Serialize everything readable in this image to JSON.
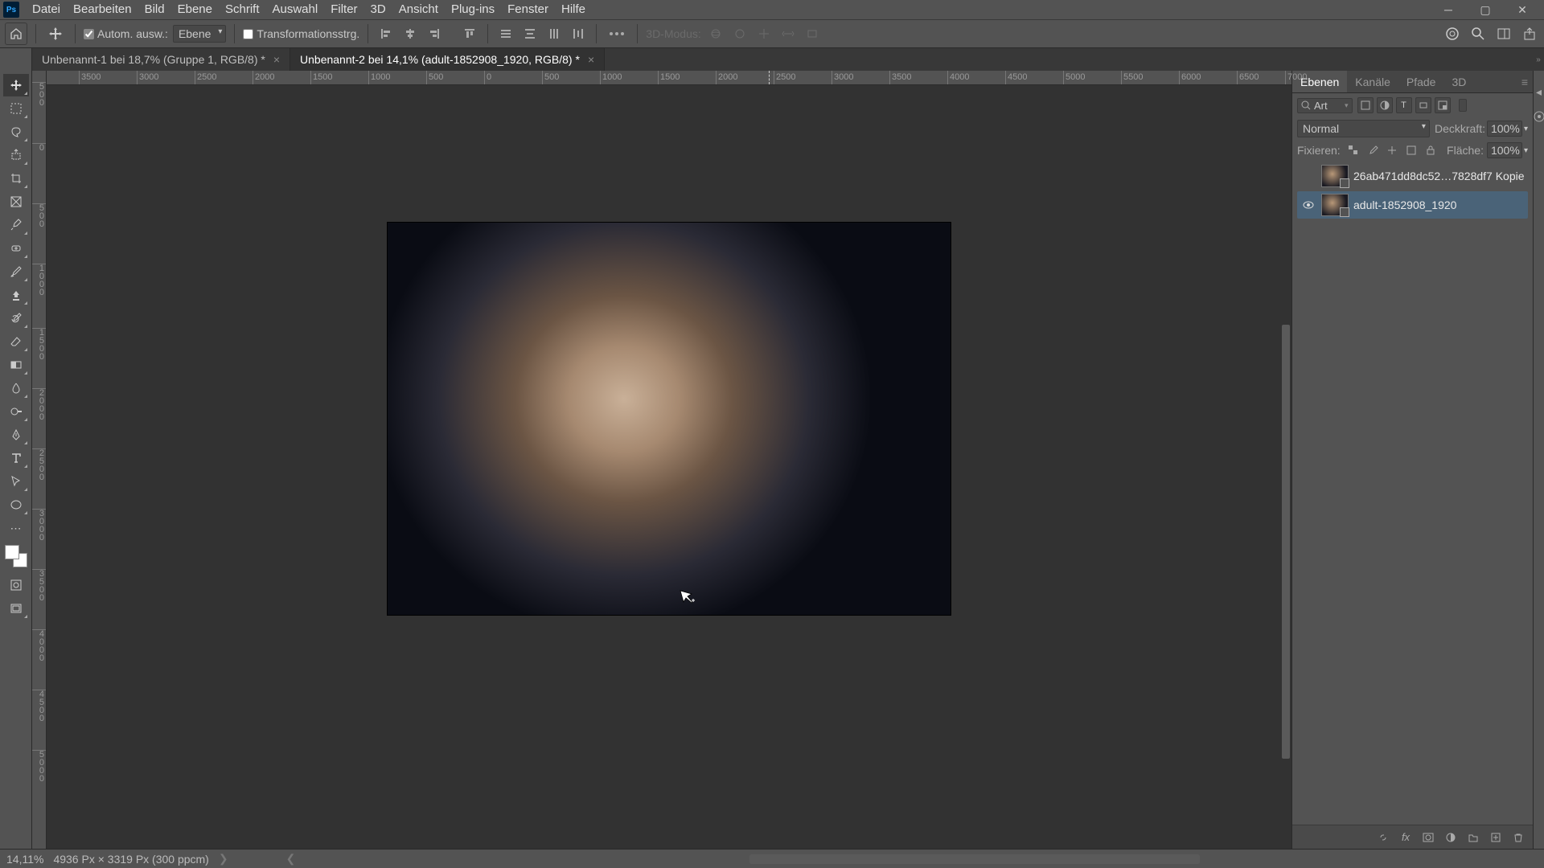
{
  "app_logo": "Ps",
  "menu": [
    "Datei",
    "Bearbeiten",
    "Bild",
    "Ebene",
    "Schrift",
    "Auswahl",
    "Filter",
    "3D",
    "Ansicht",
    "Plug-ins",
    "Fenster",
    "Hilfe"
  ],
  "options": {
    "auto_select_label": "Autom. ausw.:",
    "auto_select_checked": true,
    "target_dropdown": "Ebene",
    "transform_label": "Transformationsstrg.",
    "transform_checked": false,
    "mode3d_label": "3D-Modus:"
  },
  "tabs": [
    {
      "label": "Unbenannt-1 bei 18,7% (Gruppe 1, RGB/8) *",
      "active": false
    },
    {
      "label": "Unbenannt-2 bei 14,1% (adult-1852908_1920, RGB/8) *",
      "active": true
    }
  ],
  "hruler_ticks": [
    "3500",
    "3000",
    "2500",
    "2000",
    "1500",
    "1000",
    "500",
    "0",
    "500",
    "1000",
    "1500",
    "2000",
    "2500",
    "3000",
    "3500",
    "4000",
    "4500",
    "5000",
    "5500",
    "6000",
    "6500",
    "7000"
  ],
  "vruler_ticks": [
    {
      "pos": 14,
      "label": "5\n0\n0"
    },
    {
      "pos": 90,
      "label": "0"
    },
    {
      "pos": 165,
      "label": "5\n0\n0"
    },
    {
      "pos": 240,
      "label": "1\n0\n0\n0"
    },
    {
      "pos": 320,
      "label": "1\n5\n0\n0"
    },
    {
      "pos": 395,
      "label": "2\n0\n0\n0"
    },
    {
      "pos": 470,
      "label": "2\n5\n0\n0"
    },
    {
      "pos": 545,
      "label": "3\n0\n0\n0"
    },
    {
      "pos": 620,
      "label": "3\n5\n0\n0"
    },
    {
      "pos": 695,
      "label": "4\n0\n0\n0"
    },
    {
      "pos": 770,
      "label": "4\n5\n0\n0"
    },
    {
      "pos": 845,
      "label": "5\n0\n0\n0"
    }
  ],
  "panels": {
    "tabs": [
      "Ebenen",
      "Kanäle",
      "Pfade",
      "3D"
    ],
    "filter_kind": "Art",
    "blend_mode": "Normal",
    "opacity_label": "Deckkraft:",
    "opacity_value": "100%",
    "lock_label": "Fixieren:",
    "fill_label": "Fläche:",
    "fill_value": "100%",
    "layers": [
      {
        "visible": false,
        "name": "26ab471dd8dc52…7828df7 Kopie",
        "selected": false
      },
      {
        "visible": true,
        "name": "adult-1852908_1920",
        "selected": true
      }
    ]
  },
  "status": {
    "zoom": "14,11%",
    "doc_info": "4936 Px × 3319 Px (300 ppcm)"
  }
}
